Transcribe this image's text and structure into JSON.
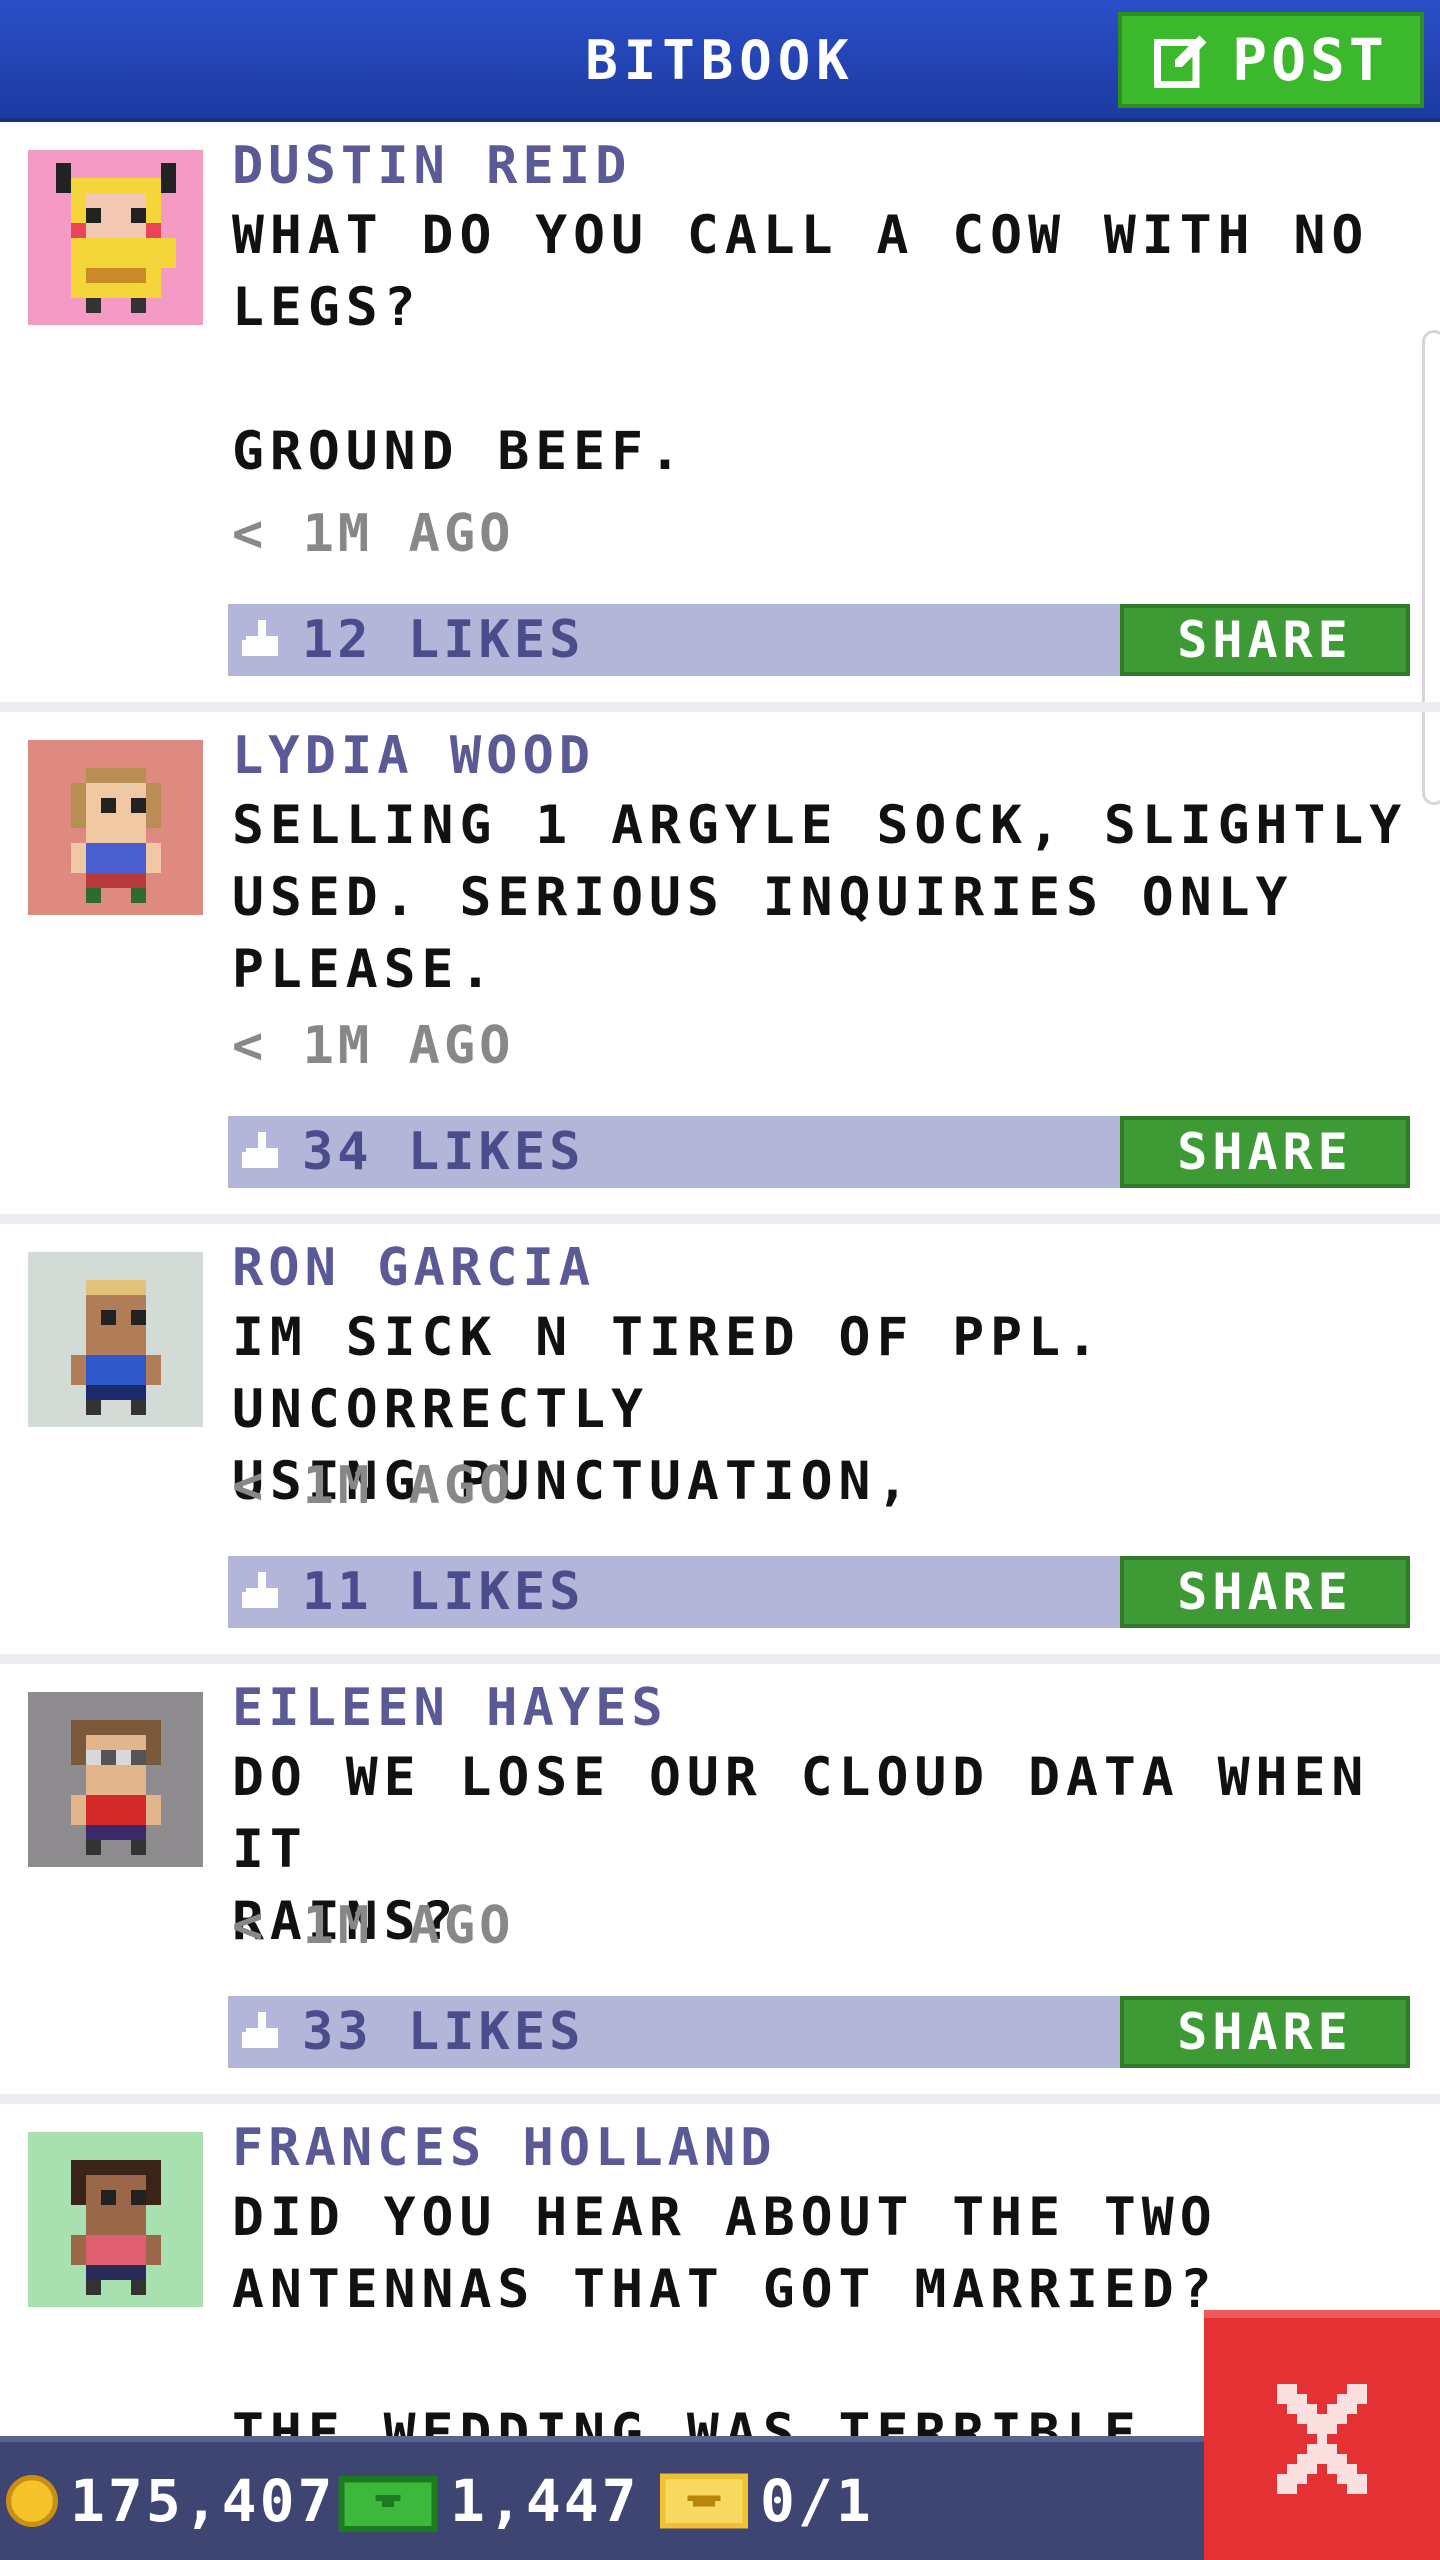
{
  "header": {
    "title": "BITBOOK",
    "post_label": "POST"
  },
  "posts": [
    {
      "author": "DUSTIN REID",
      "text": "WHAT DO YOU CALL A COW WITH NO\nLEGS?\n\nGROUND BEEF.",
      "time": "< 1M AGO",
      "likes": "12 LIKES",
      "share": "SHARE",
      "avatar_bg": "#f49ac4"
    },
    {
      "author": "LYDIA WOOD",
      "text": "SELLING 1 ARGYLE SOCK, SLIGHTLY\nUSED. SERIOUS INQUIRIES ONLY\nPLEASE.",
      "time": "< 1M AGO",
      "likes": "34 LIKES",
      "share": "SHARE",
      "avatar_bg": "#de8a80"
    },
    {
      "author": "RON GARCIA",
      "text": "IM SICK N TIRED OF PPL. UNCORRECTLY\nUSING PUNCTUATION,",
      "time": "< 1M AGO",
      "likes": "11 LIKES",
      "share": "SHARE",
      "avatar_bg": "#d3dbd6"
    },
    {
      "author": "EILEEN HAYES",
      "text": "DO WE LOSE OUR CLOUD DATA WHEN IT\nRAINS?",
      "time": "< 1M AGO",
      "likes": "33 LIKES",
      "share": "SHARE",
      "avatar_bg": "#8f8c8f"
    },
    {
      "author": "FRANCES HOLLAND",
      "text": "DID YOU HEAR ABOUT THE TWO\nANTENNAS THAT GOT MARRIED?\n\nTHE WEDDING WAS TERRIBLE, BUT",
      "avatar_bg": "#a8e0b0"
    }
  ],
  "bottom_bar": {
    "coins": "175,407",
    "cash": "1,447",
    "tickets": "0/1"
  },
  "colors": {
    "header": "#2a4fc9",
    "green": "#3e9a34",
    "like_bar": "#b3b6d8",
    "close": "#e53034"
  }
}
